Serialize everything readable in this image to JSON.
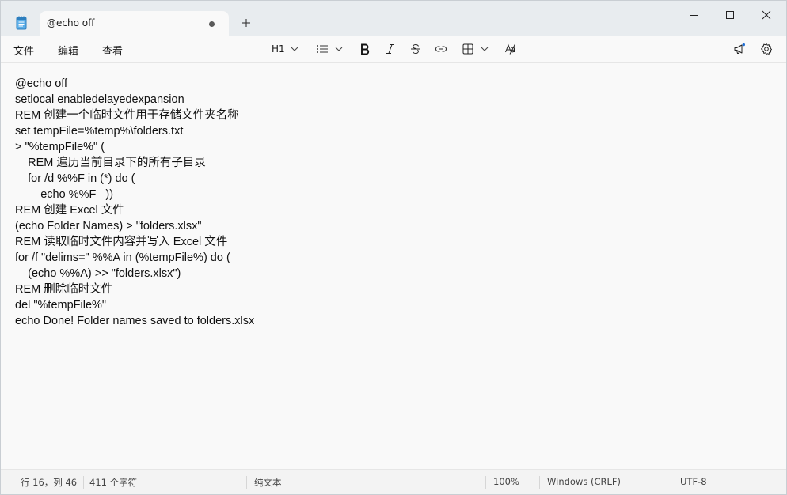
{
  "tab": {
    "title": "@echo off",
    "unsaved_indicator": "unsaved-dot"
  },
  "menu": {
    "file": "文件",
    "edit": "编辑",
    "view": "查看"
  },
  "toolbar": {
    "heading": "H1",
    "icons": [
      "list-icon",
      "bold-icon",
      "italic-icon",
      "strikethrough-icon",
      "link-icon",
      "table-icon",
      "spellcheck-icon",
      "megaphone-icon",
      "gear-icon"
    ]
  },
  "editor": {
    "lines": [
      "@echo off",
      "setlocal enabledelayedexpansion",
      "REM 创建一个临时文件用于存储文件夹名称",
      "set tempFile=%temp%\\folders.txt",
      "> \"%tempFile%\" (",
      "    REM 遍历当前目录下的所有子目录",
      "    for /d %%F in (*) do (",
      "        echo %%F   ))",
      "REM 创建 Excel 文件",
      "(echo Folder Names) > \"folders.xlsx\"",
      "REM 读取临时文件内容并写入 Excel 文件",
      "for /f \"delims=\" %%A in (%tempFile%) do (",
      "    (echo %%A) >> \"folders.xlsx\")",
      "REM 删除临时文件",
      "del \"%tempFile%\"",
      "echo Done! Folder names saved to folders.xlsx"
    ]
  },
  "status": {
    "position": "行 16，列 46",
    "chars": "411 个字符",
    "format": "纯文本",
    "zoom": "100%",
    "line_ending": "Windows (CRLF)",
    "encoding": "UTF-8"
  },
  "colors": {
    "titlebar": "#e8ecef",
    "editor_bg": "#f9f9f9",
    "app_icon": "#3a8fd1"
  }
}
